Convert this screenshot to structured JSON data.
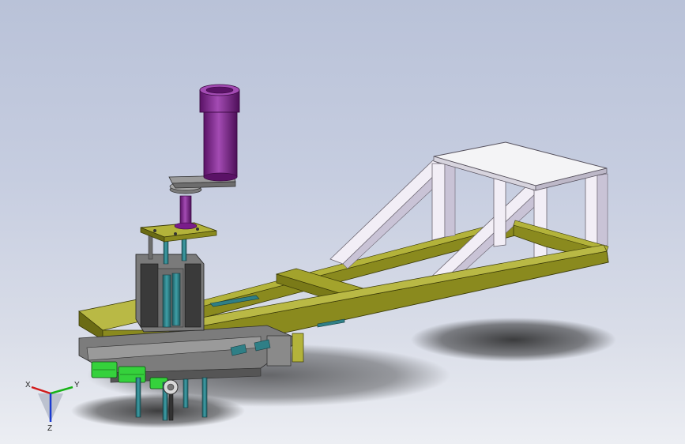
{
  "model": {
    "name": "",
    "colors": {
      "background_top": "#b9c2d8",
      "background_bottom": "#eceef3",
      "frame": "#8a8a1e",
      "frame_light": "#b3b33a",
      "frame_dark": "#5f5f12",
      "brace": "#f2eef6",
      "brace_shade": "#c9c3d6",
      "top_plate": "#f4f4f6",
      "motor": "#7a1d8a",
      "motor_light": "#a34bb3",
      "mechanism": "#6d6d6d",
      "mechanism_dark": "#3a3a3a",
      "cylinder": "#2f7f86",
      "cylinder_green": "#35d13c",
      "shadow": "#2c2c2c"
    }
  },
  "triad": {
    "x_label": "X",
    "y_label": "Y",
    "z_label": "Z",
    "x_color": "#d11a1a",
    "y_color": "#18b318",
    "z_color": "#1a3ad1"
  }
}
